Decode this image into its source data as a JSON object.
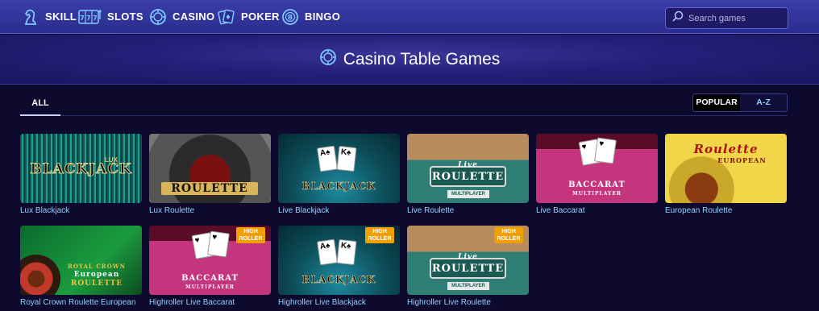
{
  "nav": {
    "items": [
      {
        "label": "SKILL",
        "icon": "chess-knight-icon"
      },
      {
        "label": "SLOTS",
        "icon": "slot-machine-icon"
      },
      {
        "label": "CASINO",
        "icon": "casino-chip-icon"
      },
      {
        "label": "POKER",
        "icon": "playing-cards-icon"
      },
      {
        "label": "BINGO",
        "icon": "bingo-ball-icon"
      }
    ],
    "search_placeholder": "Search games"
  },
  "header": {
    "title": "Casino Table Games",
    "icon": "casino-chip-icon"
  },
  "filters": {
    "tab_all": "ALL",
    "sort_popular": "POPULAR",
    "sort_az": "A-Z"
  },
  "games": [
    {
      "title": "Lux Blackjack",
      "badge": null
    },
    {
      "title": "Lux Roulette",
      "badge": null
    },
    {
      "title": "Live Blackjack",
      "badge": null
    },
    {
      "title": "Live Roulette",
      "badge": null
    },
    {
      "title": "Live Baccarat",
      "badge": null
    },
    {
      "title": "European Roulette",
      "badge": null
    },
    {
      "title": "Royal Crown Roulette European",
      "badge": null
    },
    {
      "title": "Highroller Live Baccarat",
      "badge": "HIGH ROLLER"
    },
    {
      "title": "Highroller Live Blackjack",
      "badge": "HIGH ROLLER"
    },
    {
      "title": "Highroller Live Roulette",
      "badge": "HIGH ROLLER"
    }
  ],
  "art_text": {
    "lux_blackjack": "BLACKJACK",
    "lux_badge": "LUX",
    "lux_roulette": "ROULETTE",
    "live_blackjack": "BLACKJACK",
    "live_roulette_script": "Live",
    "live_roulette": "ROULETTE",
    "multiplayer": "MULTIPLAYER",
    "baccarat": "BACCARAT",
    "european_roulette_script": "Roulette",
    "european": "EUROPEAN",
    "royal_crown": "ROYAL CROWN",
    "royal_european": "European",
    "royal_roulette": "ROULETTE",
    "high": "HIGH",
    "roller": "ROLLER"
  },
  "colors": {
    "nav_bg": "#2f3399",
    "page_bg": "#0d0a2e",
    "caption": "#8fd3ff",
    "badge": "#f2a000"
  }
}
